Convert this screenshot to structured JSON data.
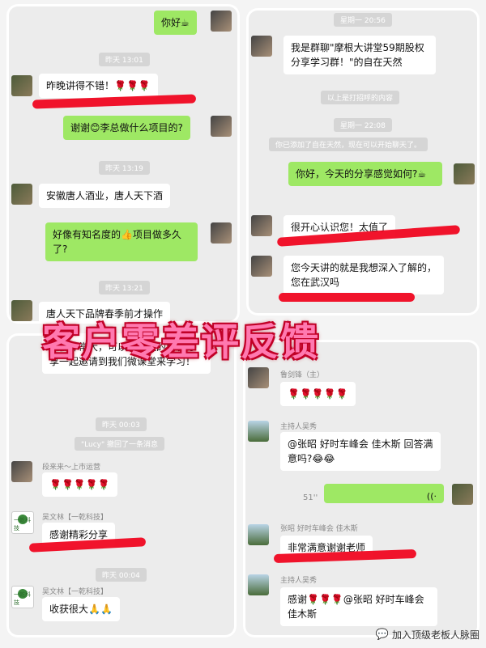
{
  "headline": "客户零差评反馈",
  "footer": {
    "icon": "chat-icon",
    "text": "加入顶级老板人脉圈"
  },
  "panel1": {
    "msg1": "你好☕",
    "ts1": "昨天 13:01",
    "msg2": "昨晚讲得不错！🌹🌹🌹",
    "msg3": "谢谢😊李总做什么项目的?",
    "ts2": "昨天 13:19",
    "msg4": "安徽唐人酒业，唐人天下酒",
    "msg5": "好像有知名度的👍项目做多久了?",
    "ts3": "昨天 13:21",
    "msg6": "唐人天下品牌春季前才操作"
  },
  "panel2": {
    "ts1": "星期一 20:56",
    "msg1": "我是群聊\"摩根大讲堂59期股权分享学习群！\"的自在天然",
    "sys1": "以上是打招呼的内容",
    "ts2": "星期一 22:08",
    "sys2": "你已添加了自在天然，现在可以开始聊天了。",
    "msg2": "你好，今天的分享感觉如何?☕",
    "msg3": "很开心认识您！太值了",
    "msg4": "您今天讲的就是我想深入了解的，您在武汉吗"
  },
  "panel3": {
    "msg1": "收获非常大，可以帮身边的朋友分享一起邀请到我们微课堂来学习！",
    "ts1": "昨天 00:03",
    "sys1": "\"Lucy\" 撤回了一条消息",
    "name1": "段来来～上市运营",
    "msg2": "🌹🌹🌹🌹🌹",
    "name2": "吴文林【一乾科技】",
    "logo": "一乾科技",
    "msg3": "感谢精彩分享",
    "ts2": "昨天 00:04",
    "name3": "吴文林【一乾科技】",
    "msg4": "收获很大🙏🙏"
  },
  "panel4": {
    "name1": "鲁剑锋（主）",
    "msg1": "🌹🌹🌹🌹🌹",
    "name2": "主持人吴秀",
    "msg2": "@张昭 好时车峰会 佳木斯 回答满意吗?😂😂",
    "voice": "51''",
    "name3": "张昭 好时车峰会 佳木斯",
    "msg3": "非常满意谢谢老师",
    "name4": "主持人吴秀",
    "msg4": "感谢🌹🌹🌹@张昭 好时车峰会 佳木斯"
  }
}
